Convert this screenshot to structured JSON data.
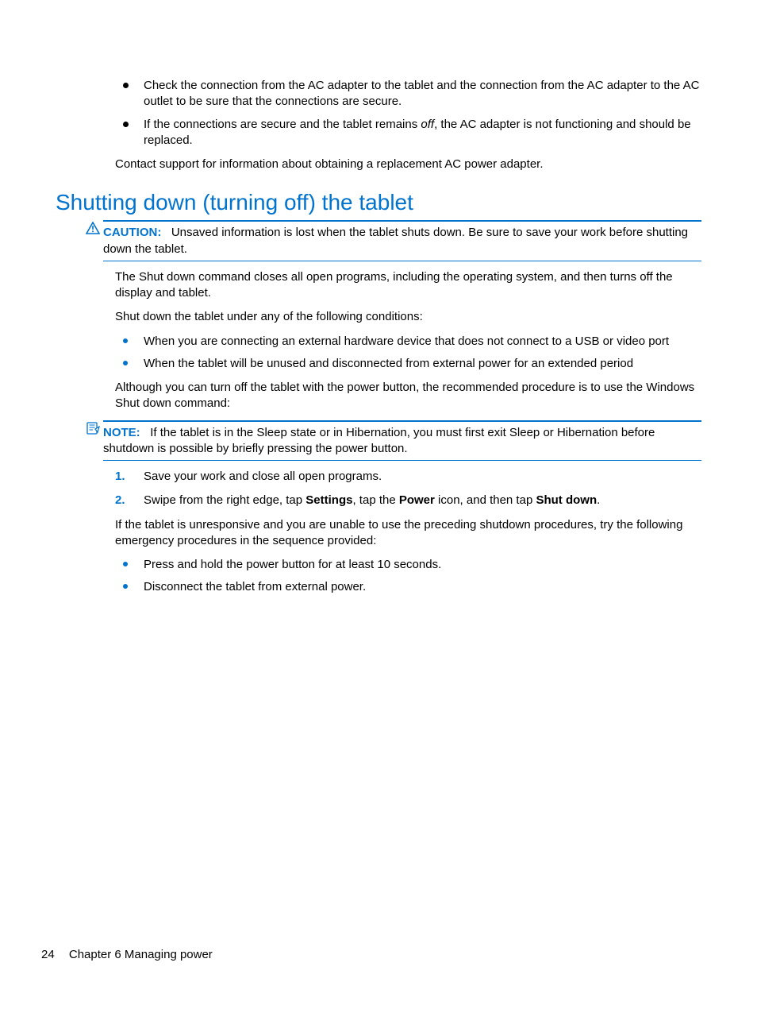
{
  "intro_bullets": [
    "Check the connection from the AC adapter to the tablet and the connection from the AC adapter to the AC outlet to be sure that the connections are secure.",
    {
      "pre": "If the connections are secure and the tablet remains ",
      "em": "off",
      "post": ", the AC adapter is not functioning and should be replaced."
    }
  ],
  "intro_para": "Contact support for information about obtaining a replacement AC power adapter.",
  "heading": "Shutting down (turning off) the tablet",
  "caution": {
    "label": "CAUTION:",
    "text": "Unsaved information is lost when the tablet shuts down. Be sure to save your work before shutting down the tablet."
  },
  "para1": "The Shut down command closes all open programs, including the operating system, and then turns off the display and tablet.",
  "para2": "Shut down the tablet under any of the following conditions:",
  "conditions": [
    "When you are connecting an external hardware device that does not connect to a USB or video port",
    "When the tablet will be unused and disconnected from external power for an extended period"
  ],
  "para3": "Although you can turn off the tablet with the power button, the recommended procedure is to use the Windows Shut down command:",
  "note": {
    "label": "NOTE:",
    "text": "If the tablet is in the Sleep state or in Hibernation, you must first exit Sleep or Hibernation before shutdown is possible by briefly pressing the power button."
  },
  "steps": [
    {
      "num": "1.",
      "text": "Save your work and close all open programs."
    },
    {
      "num": "2.",
      "pre": "Swipe from the right edge, tap ",
      "b1": "Settings",
      "mid1": ", tap the ",
      "b2": "Power",
      "mid2": " icon, and then tap ",
      "b3": "Shut down",
      "post": "."
    }
  ],
  "para4": "If the tablet is unresponsive and you are unable to use the preceding shutdown procedures, try the following emergency procedures in the sequence provided:",
  "emergency": [
    "Press and hold the power button for at least 10 seconds.",
    "Disconnect the tablet from external power."
  ],
  "footer": {
    "page": "24",
    "chapter": "Chapter 6   Managing power"
  }
}
